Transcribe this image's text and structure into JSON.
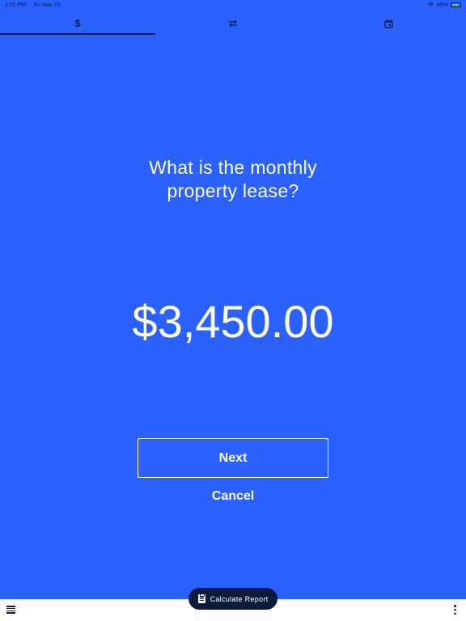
{
  "status_bar": {
    "time": "1:01 PM",
    "date": "Fri Nov 23",
    "battery": "86%",
    "battery_level": 0.86
  },
  "tabs": [
    {
      "icon": "dollar-icon",
      "glyph": "$",
      "active": true
    },
    {
      "icon": "swap-arrows-icon",
      "glyph": "⇄",
      "active": false
    },
    {
      "icon": "calendar-icon",
      "glyph": "📅",
      "active": false
    }
  ],
  "main": {
    "question_line1": "What is the monthly",
    "question_line2": "property lease?",
    "amount": "$3,450.00",
    "next_label": "Next",
    "cancel_label": "Cancel"
  },
  "bottom_bar": {
    "fab_label": "Calculate Report",
    "menu_icon": "menu-icon",
    "more_icon": "more-vertical-icon"
  },
  "colors": {
    "background": "#2b61ff",
    "dark": "#0d1b3a",
    "battery": "#4cd964"
  }
}
